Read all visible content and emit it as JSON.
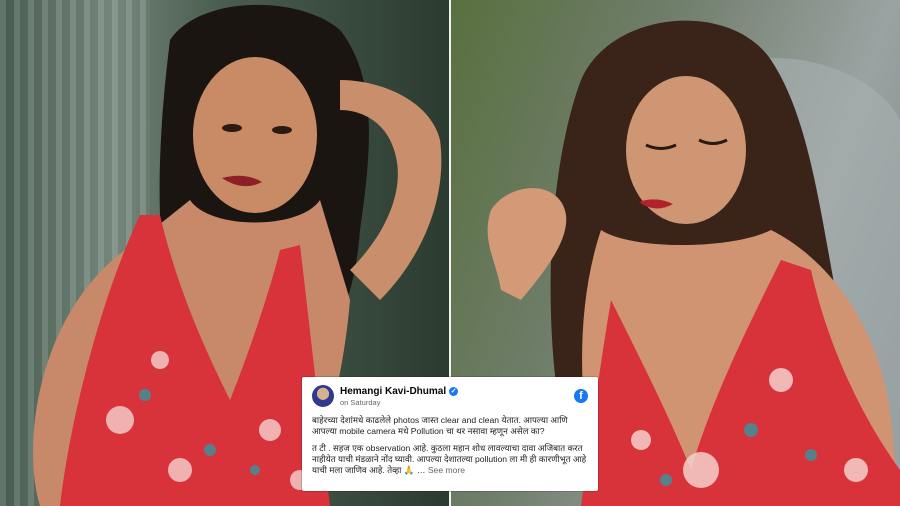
{
  "post": {
    "author": "Hemangi Kavi-Dhumal",
    "timestamp": "on Saturday",
    "paragraph1": "बाहेरच्या देशांमधे काढलेले photos जास्त clear and clean येतात. आपल्या आणि आपल्या mobile camera मधे Pollution चा थर नसावा म्हणून असेल का?",
    "paragraph2": "त टी . सहज एक observation आहे. कुठला महान शोध लावल्याचा दावा अजिबात करत नाहीयेत याची मंडळाने नोंद घ्यावी. आपल्या देशातल्या pollution ला मी ही कारणीभूत आहे याची मला जाणिव आहे. तेव्हा 🙏 …",
    "see_more": "See more"
  },
  "icons": {
    "verified": "verified-badge-icon",
    "facebook": "facebook-icon"
  },
  "colors": {
    "facebook_blue": "#1877f2",
    "dress_red": "#d8323a"
  }
}
